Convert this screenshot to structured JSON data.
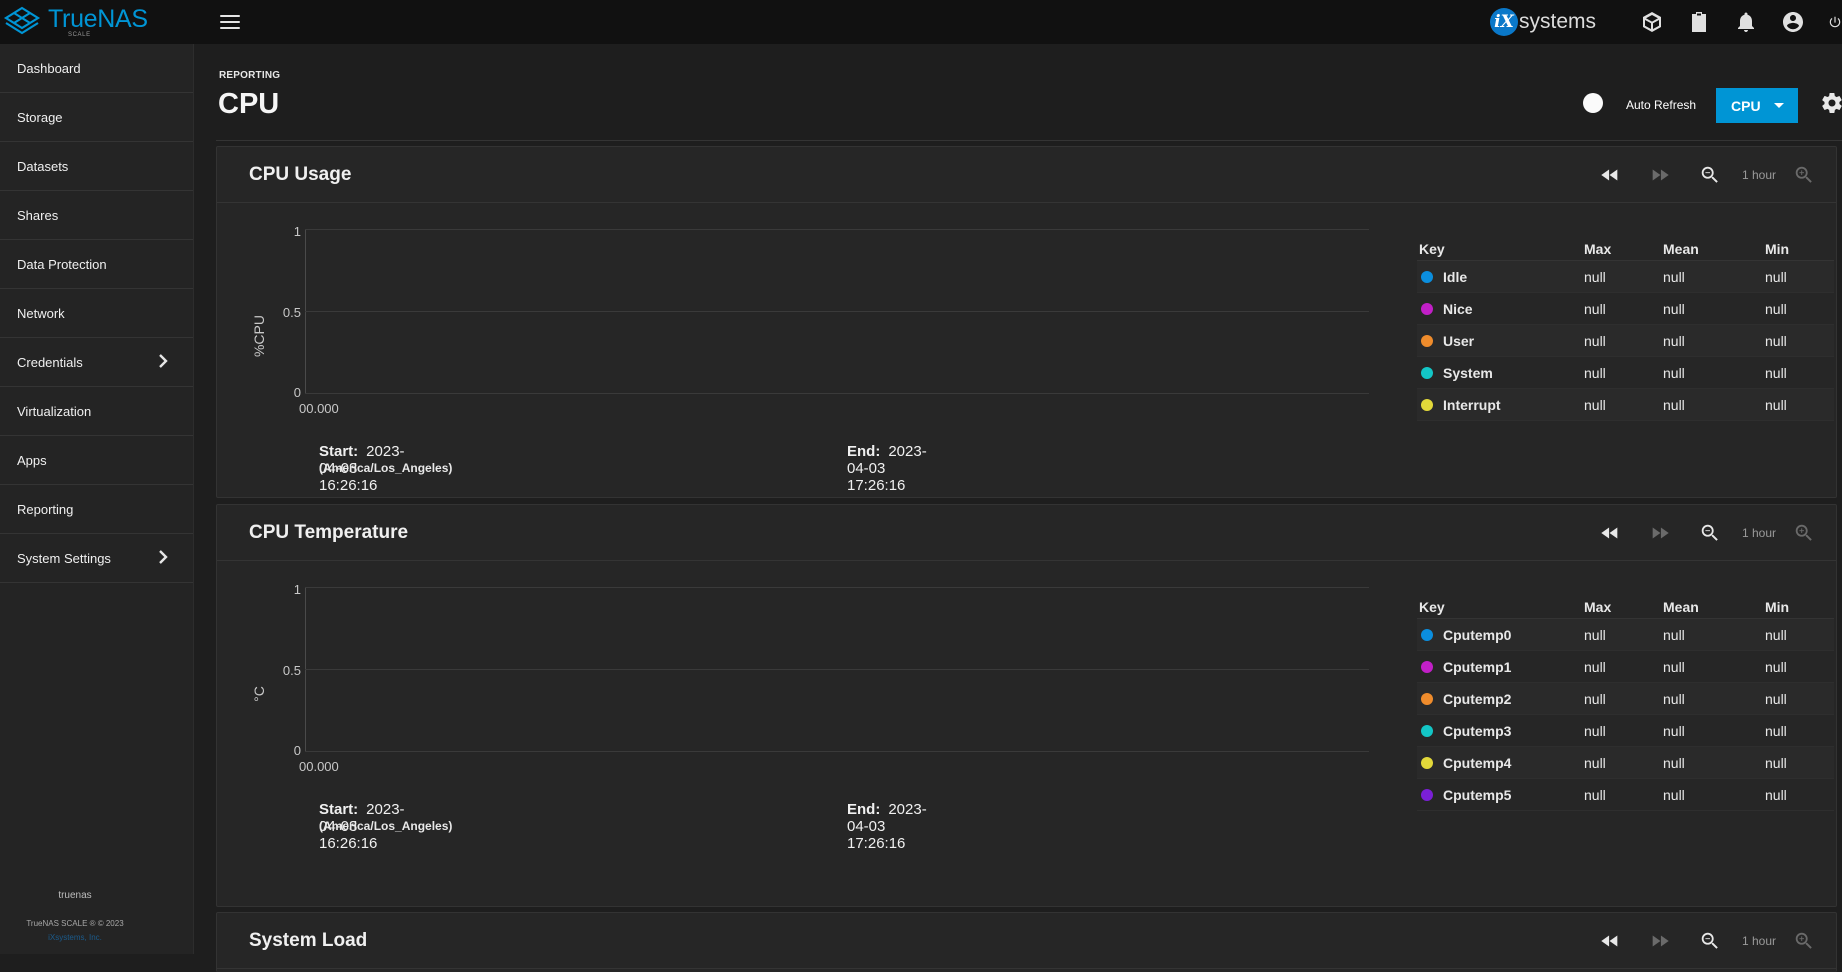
{
  "app": {
    "brand_name": "TrueNAS",
    "brand_edition": "SCALE",
    "vendor_logo_text": "systems",
    "vendor_logo_letter": "iX"
  },
  "topbar": {
    "icons": [
      "menu-icon",
      "truecommand-icon",
      "jobs-clipboard-icon",
      "notifications-bell-icon",
      "account-icon",
      "power-icon"
    ]
  },
  "sidebar": {
    "items": [
      {
        "label": "Dashboard",
        "has_children": false
      },
      {
        "label": "Storage",
        "has_children": false
      },
      {
        "label": "Datasets",
        "has_children": false
      },
      {
        "label": "Shares",
        "has_children": false
      },
      {
        "label": "Data Protection",
        "has_children": false
      },
      {
        "label": "Network",
        "has_children": false
      },
      {
        "label": "Credentials",
        "has_children": true
      },
      {
        "label": "Virtualization",
        "has_children": false
      },
      {
        "label": "Apps",
        "has_children": false
      },
      {
        "label": "Reporting",
        "has_children": false
      },
      {
        "label": "System Settings",
        "has_children": true
      }
    ],
    "hostname": "truenas",
    "copyright": "TrueNAS SCALE ® © 2023",
    "company": "iXsystems, Inc."
  },
  "header": {
    "breadcrumb": "REPORTING",
    "title": "CPU",
    "auto_refresh_label": "Auto Refresh",
    "auto_refresh_on": false,
    "report_select_value": "CPU"
  },
  "cards": [
    {
      "title": "CPU Usage",
      "range_label": "1 hour",
      "y_label": "%CPU",
      "y_ticks": [
        "1",
        "0.5",
        "0"
      ],
      "x_tick": "00.000",
      "start_label": "Start:",
      "start_value": "2023-04-03 16:26:16",
      "timezone": "(America/Los_Angeles)",
      "end_label": "End:",
      "end_value": "2023-04-03 17:26:16",
      "legend_headers": {
        "key": "Key",
        "max": "Max",
        "mean": "Mean",
        "min": "Min"
      },
      "legend": [
        {
          "name": "Idle",
          "color": "#0b8ede",
          "max": "null",
          "mean": "null",
          "min": "null"
        },
        {
          "name": "Nice",
          "color": "#c11fc7",
          "max": "null",
          "mean": "null",
          "min": "null"
        },
        {
          "name": "User",
          "color": "#ef8c2c",
          "max": "null",
          "mean": "null",
          "min": "null"
        },
        {
          "name": "System",
          "color": "#13c6c6",
          "max": "null",
          "mean": "null",
          "min": "null"
        },
        {
          "name": "Interrupt",
          "color": "#e2d83a",
          "max": "null",
          "mean": "null",
          "min": "null"
        }
      ]
    },
    {
      "title": "CPU Temperature",
      "range_label": "1 hour",
      "y_label": "°C",
      "y_ticks": [
        "1",
        "0.5",
        "0"
      ],
      "x_tick": "00.000",
      "start_label": "Start:",
      "start_value": "2023-04-03 16:26:16",
      "timezone": "(America/Los_Angeles)",
      "end_label": "End:",
      "end_value": "2023-04-03 17:26:16",
      "legend_headers": {
        "key": "Key",
        "max": "Max",
        "mean": "Mean",
        "min": "Min"
      },
      "legend": [
        {
          "name": "Cputemp0",
          "color": "#0b8ede",
          "max": "null",
          "mean": "null",
          "min": "null"
        },
        {
          "name": "Cputemp1",
          "color": "#c11fc7",
          "max": "null",
          "mean": "null",
          "min": "null"
        },
        {
          "name": "Cputemp2",
          "color": "#ef8c2c",
          "max": "null",
          "mean": "null",
          "min": "null"
        },
        {
          "name": "Cputemp3",
          "color": "#13c6c6",
          "max": "null",
          "mean": "null",
          "min": "null"
        },
        {
          "name": "Cputemp4",
          "color": "#e2d83a",
          "max": "null",
          "mean": "null",
          "min": "null"
        },
        {
          "name": "Cputemp5",
          "color": "#7a1fd6",
          "max": "null",
          "mean": "null",
          "min": "null"
        }
      ]
    },
    {
      "title": "System Load",
      "range_label": "1 hour"
    }
  ],
  "colors": {
    "accent": "#0095d5",
    "topbar_bg": "#111111",
    "sidebar_bg": "#242424",
    "card_bg": "#262626"
  }
}
